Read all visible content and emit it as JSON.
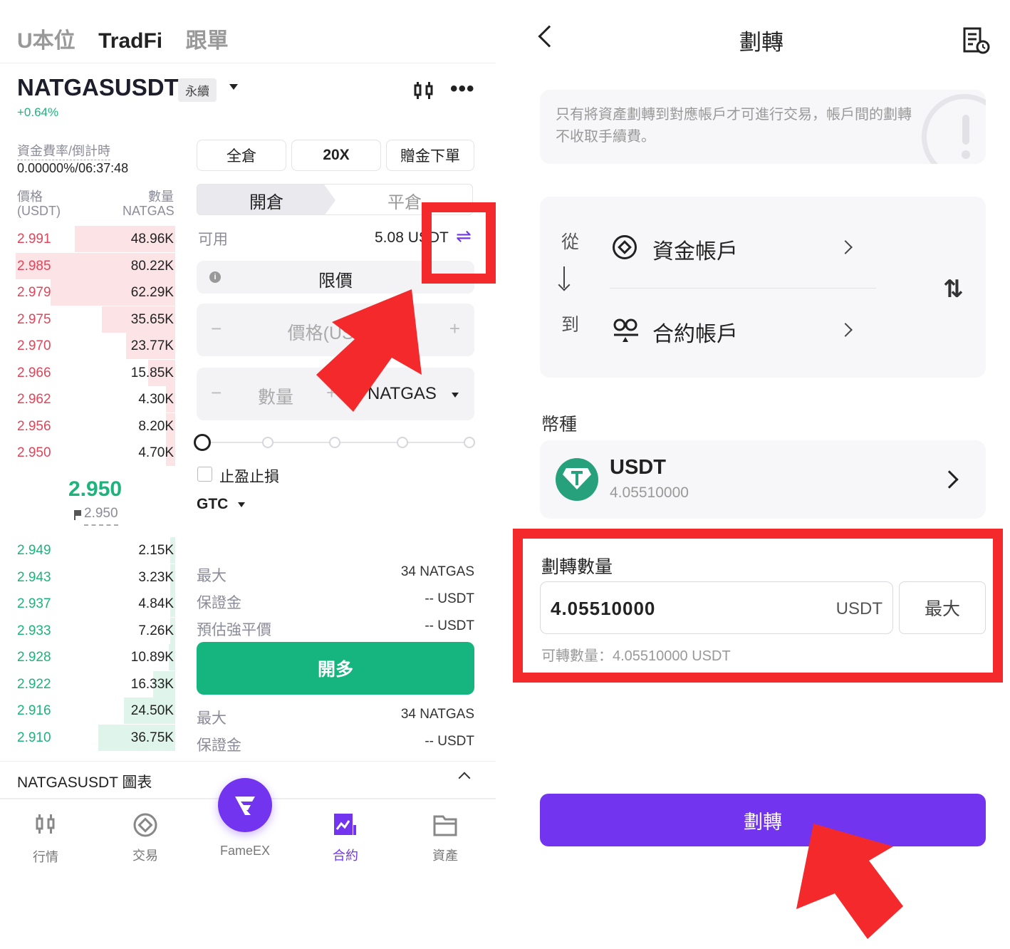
{
  "left": {
    "top_tabs": [
      "U本位",
      "TradFi",
      "跟單"
    ],
    "symbol": "NATGASUSDT",
    "perp_badge": "永續",
    "change": "+0.64%",
    "funding_label": "資金費率/倒計時",
    "funding_value": "0.00000%/06:37:48",
    "ob_header": {
      "price": "價格",
      "price_unit": "(USDT)",
      "qty": "數量",
      "qty_unit": "NATGAS"
    },
    "asks": [
      {
        "price": "2.991",
        "qty": "48.96K",
        "depth": 0.63
      },
      {
        "price": "2.985",
        "qty": "80.22K",
        "depth": 1.0
      },
      {
        "price": "2.979",
        "qty": "62.29K",
        "depth": 0.78
      },
      {
        "price": "2.975",
        "qty": "35.65K",
        "depth": 0.46
      },
      {
        "price": "2.970",
        "qty": "23.77K",
        "depth": 0.31
      },
      {
        "price": "2.966",
        "qty": "15.85K",
        "depth": 0.17
      },
      {
        "price": "2.962",
        "qty": "4.30K",
        "depth": 0.06
      },
      {
        "price": "2.956",
        "qty": "8.20K",
        "depth": 0.06
      },
      {
        "price": "2.950",
        "qty": "4.70K",
        "depth": 0.06
      }
    ],
    "last_price": "2.950",
    "mark_price": "2.950",
    "bids": [
      {
        "price": "2.949",
        "qty": "2.15K",
        "depth": 0.03
      },
      {
        "price": "2.943",
        "qty": "3.23K",
        "depth": 0.03
      },
      {
        "price": "2.937",
        "qty": "4.84K",
        "depth": 0.03
      },
      {
        "price": "2.933",
        "qty": "7.26K",
        "depth": 0.03
      },
      {
        "price": "2.928",
        "qty": "10.89K",
        "depth": 0.04
      },
      {
        "price": "2.922",
        "qty": "16.33K",
        "depth": 0.14
      },
      {
        "price": "2.916",
        "qty": "24.50K",
        "depth": 0.32
      },
      {
        "price": "2.910",
        "qty": "36.75K",
        "depth": 0.48
      }
    ],
    "margin_mode": "全倉",
    "leverage": "20X",
    "bonus": "贈金下單",
    "open_tab": "開倉",
    "close_tab": "平倉",
    "available_label": "可用",
    "available_value": "5.08 USDT",
    "order_type": "限價",
    "price_placeholder": "價格(USDT)",
    "qty_placeholder": "數量",
    "qty_unit": "NATGAS",
    "tp_sl": "止盈止損",
    "tif": "GTC",
    "long_info": [
      {
        "label": "最大",
        "value": "34 NATGAS"
      },
      {
        "label": "保證金",
        "value": "-- USDT"
      },
      {
        "label": "預估強平價",
        "value": "-- USDT"
      }
    ],
    "open_long": "開多",
    "short_info": [
      {
        "label": "最大",
        "value": "34 NATGAS"
      },
      {
        "label": "保證金",
        "value": "-- USDT"
      }
    ],
    "chart_bar_label": "NATGASUSDT 圖表",
    "bottom_nav": [
      "行情",
      "交易",
      "FameEX",
      "合約",
      "資產"
    ]
  },
  "right": {
    "title": "劃轉",
    "notice": "只有將資產劃轉到對應帳戶才可進行交易，帳戶間的劃轉不收取手續費。",
    "from_label": "從",
    "to_label": "到",
    "from_account": "資金帳戶",
    "to_account": "合約帳戶",
    "coin_label": "幣種",
    "coin_name": "USDT",
    "coin_balance": "4.05510000",
    "amount_label": "劃轉數量",
    "amount_value": "4.05510000",
    "amount_unit": "USDT",
    "max_button": "最大",
    "transferable": "可轉數量：4.05510000 USDT",
    "submit": "劃轉"
  },
  "colors": {
    "accent": "#7234ee",
    "buy": "#16b57f",
    "sell": "#e0465a",
    "highlight": "#f3292b"
  }
}
